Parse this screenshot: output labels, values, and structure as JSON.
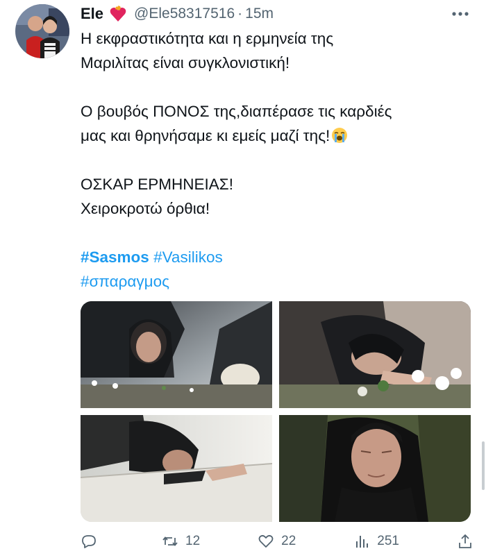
{
  "tweet": {
    "author_name": "Ele",
    "handle": "@Ele58317516",
    "separator": "·",
    "time": "15m",
    "lines": [
      "Η εκφραστικότητα και η ερμηνεία της",
      "Μαριλίτας  είναι συγκλονιστική!",
      "",
      "Ο βουβός ΠΟΝΟΣ της,διαπέρασε τις καρδιές",
      "μας και θρηνήσαμε κι εμείς μαζί της!",
      "",
      "ΟΣΚΑΡ ΕΡΜΗΝΕΙΑΣ!",
      "Χειροκροτώ όρθια!",
      ""
    ],
    "hashtags_line1": [
      "#Sasmos",
      "#Vasilikos"
    ],
    "hashtags_line2": [
      "#σπαραγμος"
    ],
    "emoji": "loudly-crying-face-emoji",
    "heart_emoji": "heart-on-fire-emoji"
  },
  "actions": {
    "reply_count": "",
    "retweet_count": "12",
    "like_count": "22",
    "views_count": "251"
  },
  "icons": [
    "heart-on-fire-icon",
    "more-icon",
    "reply-icon",
    "retweet-icon",
    "like-icon",
    "views-icon",
    "share-icon"
  ],
  "colors": {
    "text": "#0f1419",
    "secondary": "#536471",
    "link": "#1d9bf0"
  }
}
